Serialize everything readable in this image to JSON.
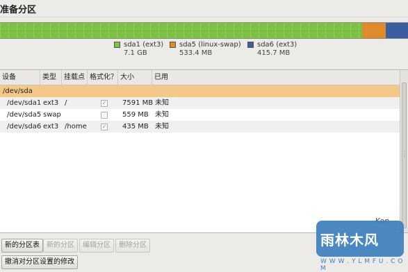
{
  "page": {
    "title": "准备分区"
  },
  "partition_bar": {
    "segments": [
      {
        "fraction": 0.888,
        "color": "#7dc241"
      },
      {
        "fraction": 0.058,
        "color": "#e18a2a"
      },
      {
        "fraction": 0.054,
        "color": "#3b5f9e"
      }
    ]
  },
  "legend": [
    {
      "name": "sda1 (ext3)",
      "size": "7.1 GB",
      "color": "#7dc241"
    },
    {
      "name": "sda5 (linux-swap)",
      "size": "533.4 MB",
      "color": "#e18a2a"
    },
    {
      "name": "sda6 (ext3)",
      "size": "415.7 MB",
      "color": "#3b5f9e"
    }
  ],
  "table": {
    "columns": [
      "设备",
      "类型",
      "挂载点",
      "格式化？",
      "大小",
      "已用"
    ],
    "disk": "/dev/sda",
    "rows": [
      {
        "device": "/dev/sda1",
        "type": "ext3",
        "mount": "/",
        "format": "✓",
        "size": "7591 MB",
        "used": "未知"
      },
      {
        "device": "/dev/sda5",
        "type": "swap",
        "mount": "",
        "format": "",
        "size": "559 MB",
        "used": "未知"
      },
      {
        "device": "/dev/sda6",
        "type": "ext3",
        "mount": "/home",
        "format": "✓",
        "size": "435 MB",
        "used": "未知"
      }
    ]
  },
  "buttons": {
    "new_table": "新的分区表",
    "new_partition": "新的分区",
    "edit_partition": "编辑分区",
    "delete_partition": "删除分区",
    "revert": "撤消对分区设置的修改"
  },
  "watermark": {
    "title": "雨林木风",
    "url": "W W W . Y L M F U . C O M",
    "corner_text": "Kon"
  }
}
